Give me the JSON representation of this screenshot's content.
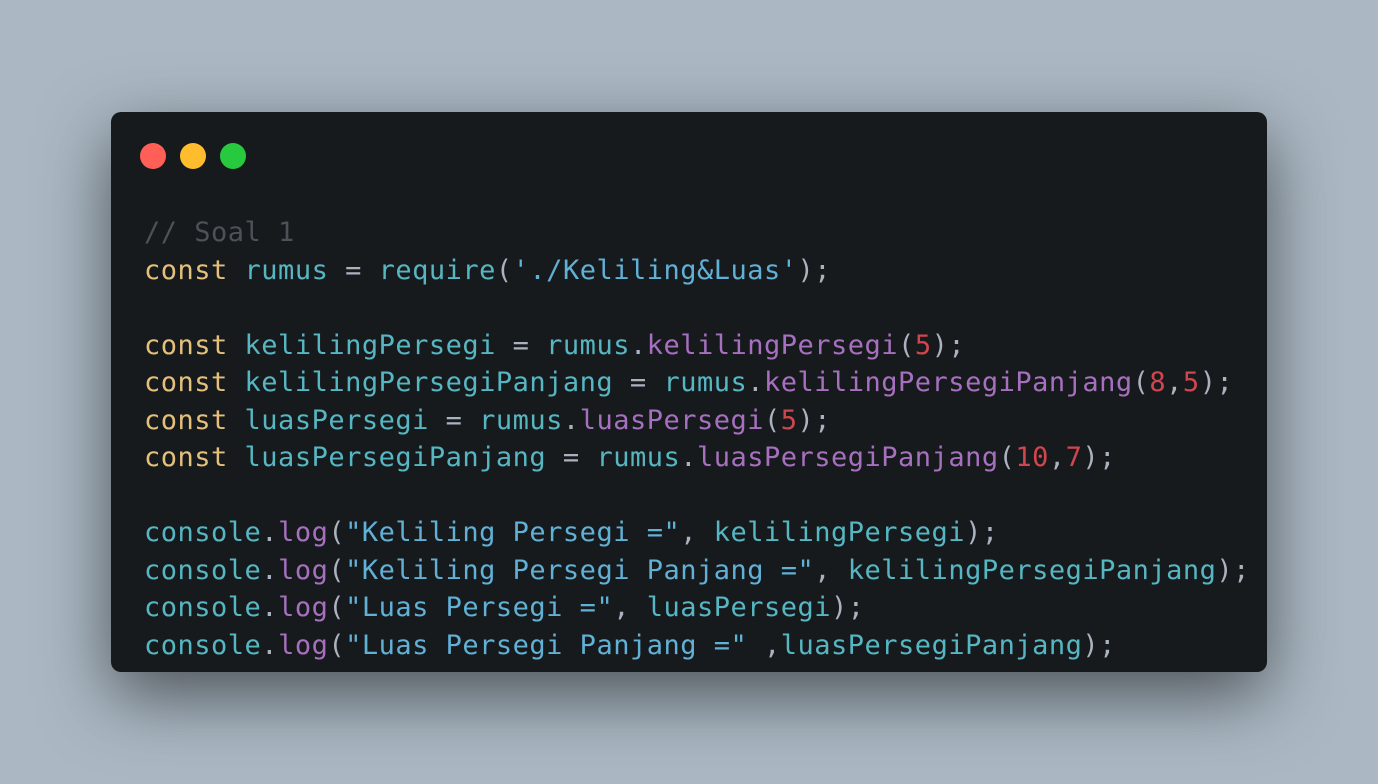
{
  "window": {
    "controls": [
      {
        "name": "close",
        "color": "#ff5f56"
      },
      {
        "name": "minimize",
        "color": "#ffbd2e"
      },
      {
        "name": "maximize",
        "color": "#27c93f"
      }
    ]
  },
  "theme": {
    "background": "#abb8c3",
    "editor_bg": "#171a1d",
    "keyword": "#e5c07b",
    "identifier": "#56b6c2",
    "method": "#a670bf",
    "number": "#d0464f",
    "string": "#61b0d6",
    "comment": "#4b5259",
    "punctuation": "#abb2bf"
  },
  "code": {
    "lines": [
      [
        {
          "t": "comment",
          "v": "// Soal 1"
        }
      ],
      [
        {
          "t": "keyword",
          "v": "const"
        },
        {
          "t": "punct",
          "v": " "
        },
        {
          "t": "ident",
          "v": "rumus"
        },
        {
          "t": "punct",
          "v": " = "
        },
        {
          "t": "ident",
          "v": "require"
        },
        {
          "t": "punct",
          "v": "("
        },
        {
          "t": "string",
          "v": "'./Keliling&Luas'"
        },
        {
          "t": "punct",
          "v": ");"
        }
      ],
      [],
      [
        {
          "t": "keyword",
          "v": "const"
        },
        {
          "t": "punct",
          "v": " "
        },
        {
          "t": "ident",
          "v": "kelilingPersegi"
        },
        {
          "t": "punct",
          "v": " = "
        },
        {
          "t": "ident",
          "v": "rumus"
        },
        {
          "t": "punct",
          "v": "."
        },
        {
          "t": "method",
          "v": "kelilingPersegi"
        },
        {
          "t": "punct",
          "v": "("
        },
        {
          "t": "number",
          "v": "5"
        },
        {
          "t": "punct",
          "v": ");"
        }
      ],
      [
        {
          "t": "keyword",
          "v": "const"
        },
        {
          "t": "punct",
          "v": " "
        },
        {
          "t": "ident",
          "v": "kelilingPersegiPanjang"
        },
        {
          "t": "punct",
          "v": " = "
        },
        {
          "t": "ident",
          "v": "rumus"
        },
        {
          "t": "punct",
          "v": "."
        },
        {
          "t": "method",
          "v": "kelilingPersegiPanjang"
        },
        {
          "t": "punct",
          "v": "("
        },
        {
          "t": "number",
          "v": "8"
        },
        {
          "t": "punct",
          "v": ","
        },
        {
          "t": "number",
          "v": "5"
        },
        {
          "t": "punct",
          "v": ");"
        }
      ],
      [
        {
          "t": "keyword",
          "v": "const"
        },
        {
          "t": "punct",
          "v": " "
        },
        {
          "t": "ident",
          "v": "luasPersegi"
        },
        {
          "t": "punct",
          "v": " = "
        },
        {
          "t": "ident",
          "v": "rumus"
        },
        {
          "t": "punct",
          "v": "."
        },
        {
          "t": "method",
          "v": "luasPersegi"
        },
        {
          "t": "punct",
          "v": "("
        },
        {
          "t": "number",
          "v": "5"
        },
        {
          "t": "punct",
          "v": ");"
        }
      ],
      [
        {
          "t": "keyword",
          "v": "const"
        },
        {
          "t": "punct",
          "v": " "
        },
        {
          "t": "ident",
          "v": "luasPersegiPanjang"
        },
        {
          "t": "punct",
          "v": " = "
        },
        {
          "t": "ident",
          "v": "rumus"
        },
        {
          "t": "punct",
          "v": "."
        },
        {
          "t": "method",
          "v": "luasPersegiPanjang"
        },
        {
          "t": "punct",
          "v": "("
        },
        {
          "t": "number",
          "v": "10"
        },
        {
          "t": "punct",
          "v": ","
        },
        {
          "t": "number",
          "v": "7"
        },
        {
          "t": "punct",
          "v": ");"
        }
      ],
      [],
      [
        {
          "t": "ident",
          "v": "console"
        },
        {
          "t": "punct",
          "v": "."
        },
        {
          "t": "method",
          "v": "log"
        },
        {
          "t": "punct",
          "v": "("
        },
        {
          "t": "string",
          "v": "\"Keliling Persegi =\""
        },
        {
          "t": "punct",
          "v": ", "
        },
        {
          "t": "ident",
          "v": "kelilingPersegi"
        },
        {
          "t": "punct",
          "v": ");"
        }
      ],
      [
        {
          "t": "ident",
          "v": "console"
        },
        {
          "t": "punct",
          "v": "."
        },
        {
          "t": "method",
          "v": "log"
        },
        {
          "t": "punct",
          "v": "("
        },
        {
          "t": "string",
          "v": "\"Keliling Persegi Panjang =\""
        },
        {
          "t": "punct",
          "v": ", "
        },
        {
          "t": "ident",
          "v": "kelilingPersegiPanjang"
        },
        {
          "t": "punct",
          "v": ");"
        }
      ],
      [
        {
          "t": "ident",
          "v": "console"
        },
        {
          "t": "punct",
          "v": "."
        },
        {
          "t": "method",
          "v": "log"
        },
        {
          "t": "punct",
          "v": "("
        },
        {
          "t": "string",
          "v": "\"Luas Persegi =\""
        },
        {
          "t": "punct",
          "v": ", "
        },
        {
          "t": "ident",
          "v": "luasPersegi"
        },
        {
          "t": "punct",
          "v": ");"
        }
      ],
      [
        {
          "t": "ident",
          "v": "console"
        },
        {
          "t": "punct",
          "v": "."
        },
        {
          "t": "method",
          "v": "log"
        },
        {
          "t": "punct",
          "v": "("
        },
        {
          "t": "string",
          "v": "\"Luas Persegi Panjang =\""
        },
        {
          "t": "punct",
          "v": " ,"
        },
        {
          "t": "ident",
          "v": "luasPersegiPanjang"
        },
        {
          "t": "punct",
          "v": ");"
        }
      ]
    ]
  }
}
